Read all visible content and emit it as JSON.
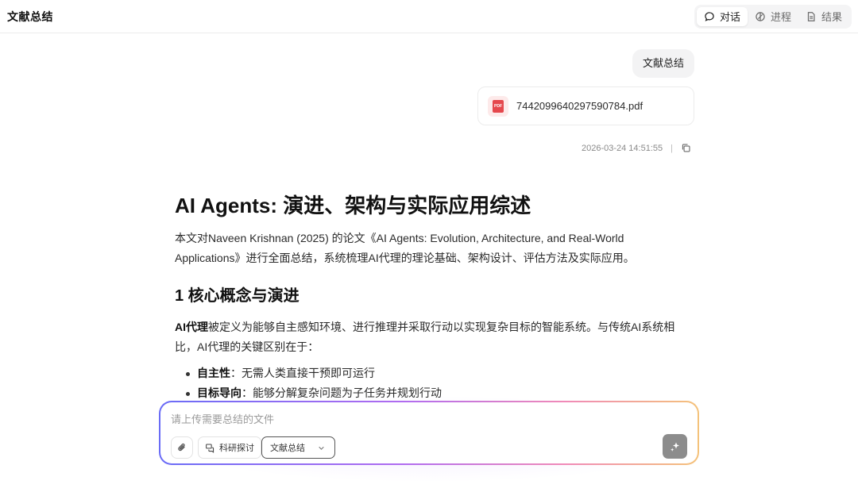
{
  "app": {
    "title": "文献总结"
  },
  "tabs": [
    {
      "label": "对话",
      "icon": "chat-bubble-icon",
      "active": true
    },
    {
      "label": "进程",
      "icon": "progress-icon",
      "active": false
    },
    {
      "label": "结果",
      "icon": "document-icon",
      "active": false
    }
  ],
  "conversation": {
    "user_message": "文献总结",
    "attachment": {
      "file_name": "7442099640297590784.pdf",
      "icon": "pdf-icon"
    },
    "timestamp": "2026-03-24 14:51:55",
    "separator": "|"
  },
  "document": {
    "title": "AI Agents: 演进、架构与实际应用综述",
    "intro": "本文对Naveen Krishnan (2025) 的论文《AI Agents: Evolution, Architecture, and Real-World Applications》进行全面总结，系统梳理AI代理的理论基础、架构设计、评估方法及实际应用。",
    "section1": {
      "heading": "1 核心概念与演进",
      "para_bold": "AI代理",
      "para_rest": "被定义为能够自主感知环境、进行推理并采取行动以实现复杂目标的智能系统。与传统AI系统相比，AI代理的关键区别在于：",
      "bullets": [
        {
          "term": "自主性",
          "desc": "：无需人类直接干预即可运行"
        },
        {
          "term": "目标导向",
          "desc": "：能够分解复杂问题为子任务并规划行动"
        }
      ]
    }
  },
  "composer": {
    "placeholder": "请上传需要总结的文件",
    "research_chip": "科研探讨",
    "mode_select": "文献总结"
  },
  "colors": {
    "accent_gradient": [
      "#6a6cf6",
      "#b06cf0",
      "#f08ab8",
      "#f4c27a"
    ],
    "send_button": "#8c8c8c",
    "pdf_red": "#e5484d"
  }
}
